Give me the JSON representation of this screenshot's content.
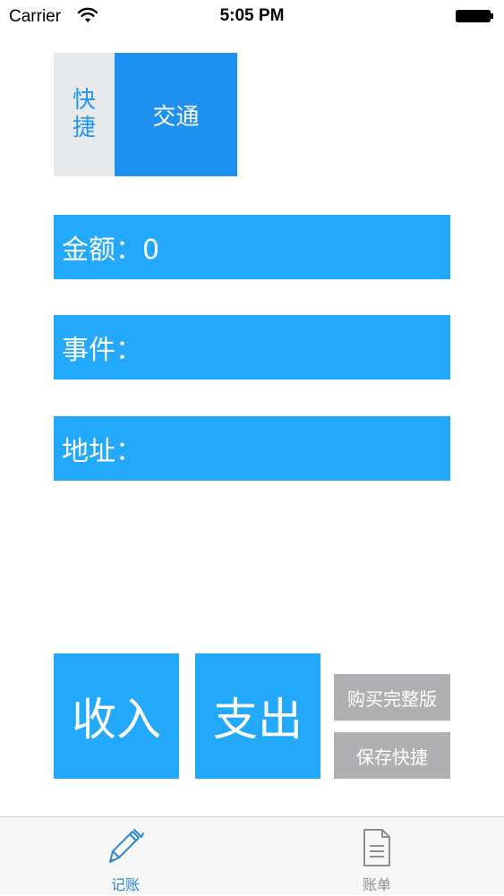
{
  "status_bar": {
    "carrier": "Carrier",
    "time": "5:05 PM"
  },
  "shortcuts": {
    "tab_label": "快捷",
    "items": [
      "交通"
    ]
  },
  "fields": {
    "amount": "金额：0",
    "event": "事件：",
    "address": "地址："
  },
  "actions": {
    "income": "收入",
    "expense": "支出",
    "buy_full": "购买完整版",
    "save_shortcut": "保存快捷"
  },
  "tab_bar": {
    "items": [
      {
        "label": "记账",
        "icon": "pen-icon",
        "active": true
      },
      {
        "label": "账单",
        "icon": "document-icon",
        "active": false
      }
    ]
  },
  "colors": {
    "primary_blue": "#22a9fb",
    "shortcut_blue": "#1e90ef",
    "tab_active": "#2a88d6",
    "tab_inactive": "#8f8f8f",
    "gray_button": "#b0afb1"
  }
}
